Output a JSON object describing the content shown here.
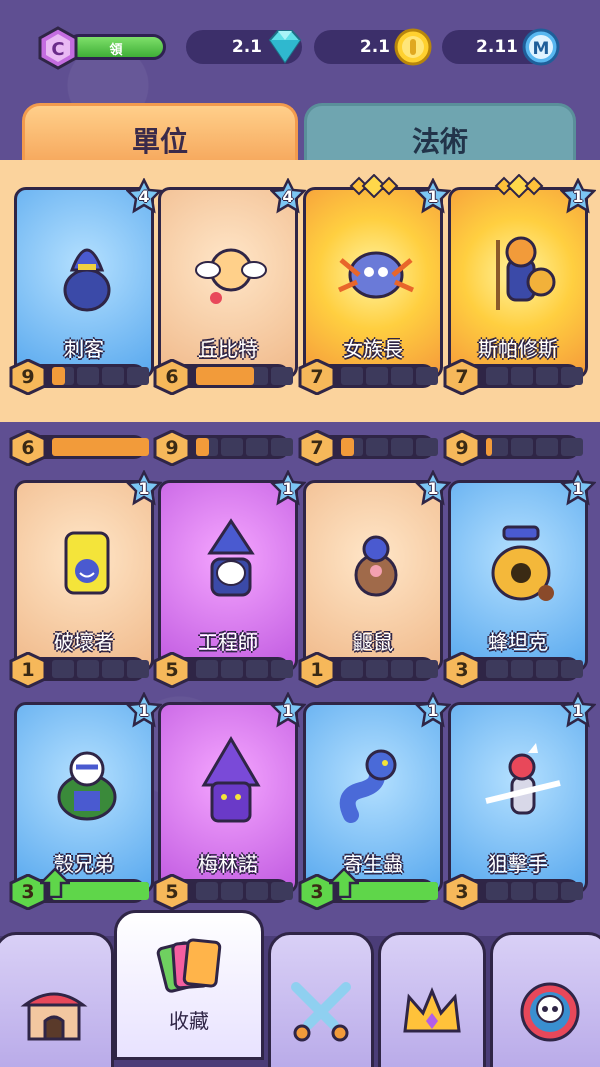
{
  "topbar": {
    "vip_label": "領",
    "vip_badge": "C",
    "resources": [
      {
        "value": "2.1",
        "icon": "gem-icon"
      },
      {
        "value": "2.1",
        "icon": "coin-icon"
      },
      {
        "value": "2.11",
        "icon": "m-token-icon"
      }
    ]
  },
  "tabs": [
    {
      "label": "單位",
      "active": true
    },
    {
      "label": "法術",
      "active": false
    }
  ],
  "deck_cards": [
    {
      "name": "刺客",
      "stars": "4",
      "level": "9",
      "progress": 0.13,
      "bg": "blue",
      "icon": "assassin-icon"
    },
    {
      "name": "丘比特",
      "stars": "4",
      "level": "6",
      "progress": 0.6,
      "bg": "tan",
      "icon": "cupid-icon"
    },
    {
      "name": "女族長",
      "stars": "1",
      "level": "7",
      "progress": 0.0,
      "bg": "gold",
      "icon": "spider-matriarch-icon"
    },
    {
      "name": "斯帕修斯",
      "stars": "1",
      "level": "7",
      "progress": 0.0,
      "bg": "gold",
      "icon": "spartan-icon"
    }
  ],
  "hidden_row_levels": [
    {
      "level": "6",
      "progress": 1.0
    },
    {
      "level": "9",
      "progress": 0.13
    },
    {
      "level": "7",
      "progress": 0.13
    },
    {
      "level": "9",
      "progress": 0.06
    }
  ],
  "collection_cards": [
    {
      "name": "破壞者",
      "stars": "1",
      "level": "1",
      "progress": 0.0,
      "bg": "tan",
      "icon": "barrel-icon",
      "upgrade": false
    },
    {
      "name": "工程師",
      "stars": "1",
      "level": "5",
      "progress": 0.0,
      "bg": "purple",
      "icon": "engineer-icon",
      "upgrade": false
    },
    {
      "name": "鼴鼠",
      "stars": "1",
      "level": "1",
      "progress": 0.0,
      "bg": "tan",
      "icon": "mole-icon",
      "upgrade": false
    },
    {
      "name": "蜂坦克",
      "stars": "1",
      "level": "3",
      "progress": 0.0,
      "bg": "blue",
      "icon": "bee-tank-icon",
      "upgrade": false
    },
    {
      "name": "殼兄弟",
      "stars": "1",
      "level": "3",
      "progress": 1.0,
      "bg": "blue",
      "icon": "turtle-icon",
      "upgrade": true
    },
    {
      "name": "梅林諾",
      "stars": "1",
      "level": "5",
      "progress": 0.0,
      "bg": "purple",
      "icon": "wizard-icon",
      "upgrade": false
    },
    {
      "name": "寄生蟲",
      "stars": "1",
      "level": "3",
      "progress": 1.0,
      "bg": "blue",
      "icon": "worm-icon",
      "upgrade": true
    },
    {
      "name": "狙擊手",
      "stars": "1",
      "level": "3",
      "progress": 0.0,
      "bg": "blue",
      "icon": "sniper-icon",
      "upgrade": false
    }
  ],
  "bottom_nav": [
    {
      "label": "",
      "icon": "shop-icon",
      "active": false
    },
    {
      "label": "收藏",
      "icon": "cards-icon",
      "active": true
    },
    {
      "label": "",
      "icon": "battle-swords-icon",
      "active": false
    },
    {
      "label": "",
      "icon": "crown-icon",
      "active": false
    },
    {
      "label": "",
      "icon": "skull-icon",
      "active": false
    }
  ],
  "colors": {
    "background": "#5f4f92",
    "deck_panel": "#fbd39d",
    "progress_orange": "#f29b3a",
    "progress_green": "#5fd64a"
  }
}
